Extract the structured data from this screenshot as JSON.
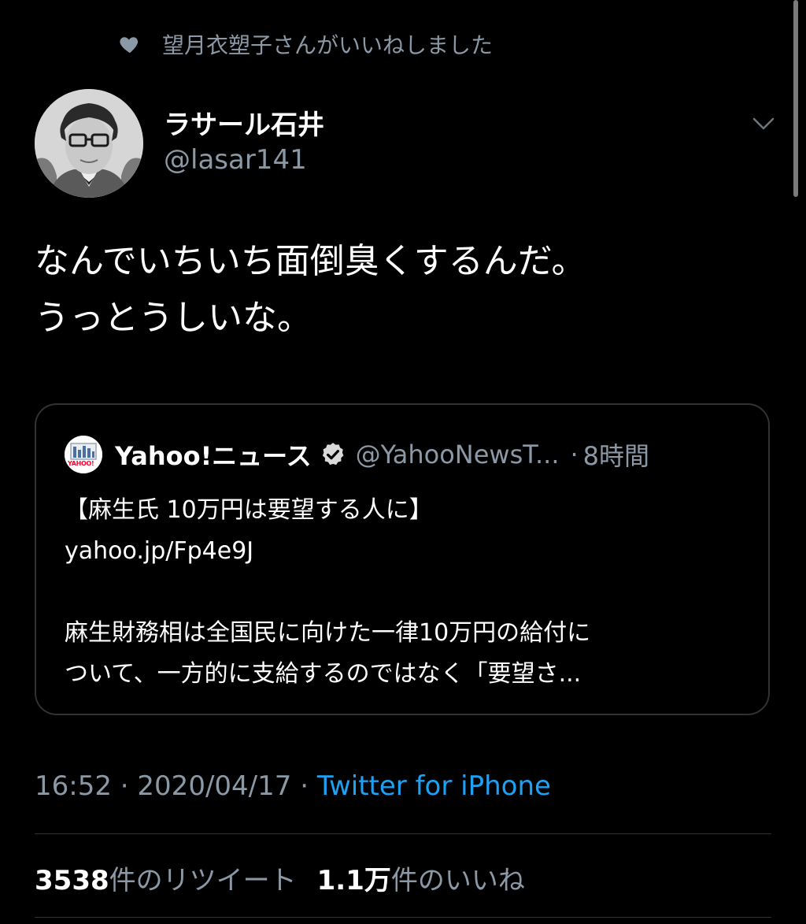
{
  "social_context": {
    "text": "望月衣塑子さんがいいねしました",
    "icon": "heart-icon"
  },
  "author": {
    "name": "ラサール石井",
    "handle": "@lasar141"
  },
  "tweet": {
    "lines": [
      "なんでいちいち面倒臭くするんだ。",
      "うっとうしいな。"
    ]
  },
  "quoted_tweet": {
    "name": "Yahoo!ニュース",
    "handle": "@YahooNewsT...",
    "separator": "·",
    "time": "8時間",
    "avatar_logo_text": "YAHOO!",
    "body_lines": [
      "【麻生氏 10万円は要望する人に】",
      "yahoo.jp/Fp4e9J",
      "",
      "麻生財務相は全国民に向けた一律10万円の給付に",
      "ついて、一方的に支給するのではなく「要望さ..."
    ]
  },
  "meta": {
    "time": "16:52",
    "separator": "·",
    "date": "2020/04/17",
    "source": "Twitter for iPhone"
  },
  "stats": {
    "retweets_count": "3538",
    "retweets_label": "件のリツイート",
    "likes_count": "1.1万",
    "likes_label": "件のいいね"
  },
  "colors": {
    "background": "#000000",
    "text": "#ffffff",
    "secondary": "#8b98a5",
    "link": "#1da1f2",
    "border": "#2f3336"
  }
}
